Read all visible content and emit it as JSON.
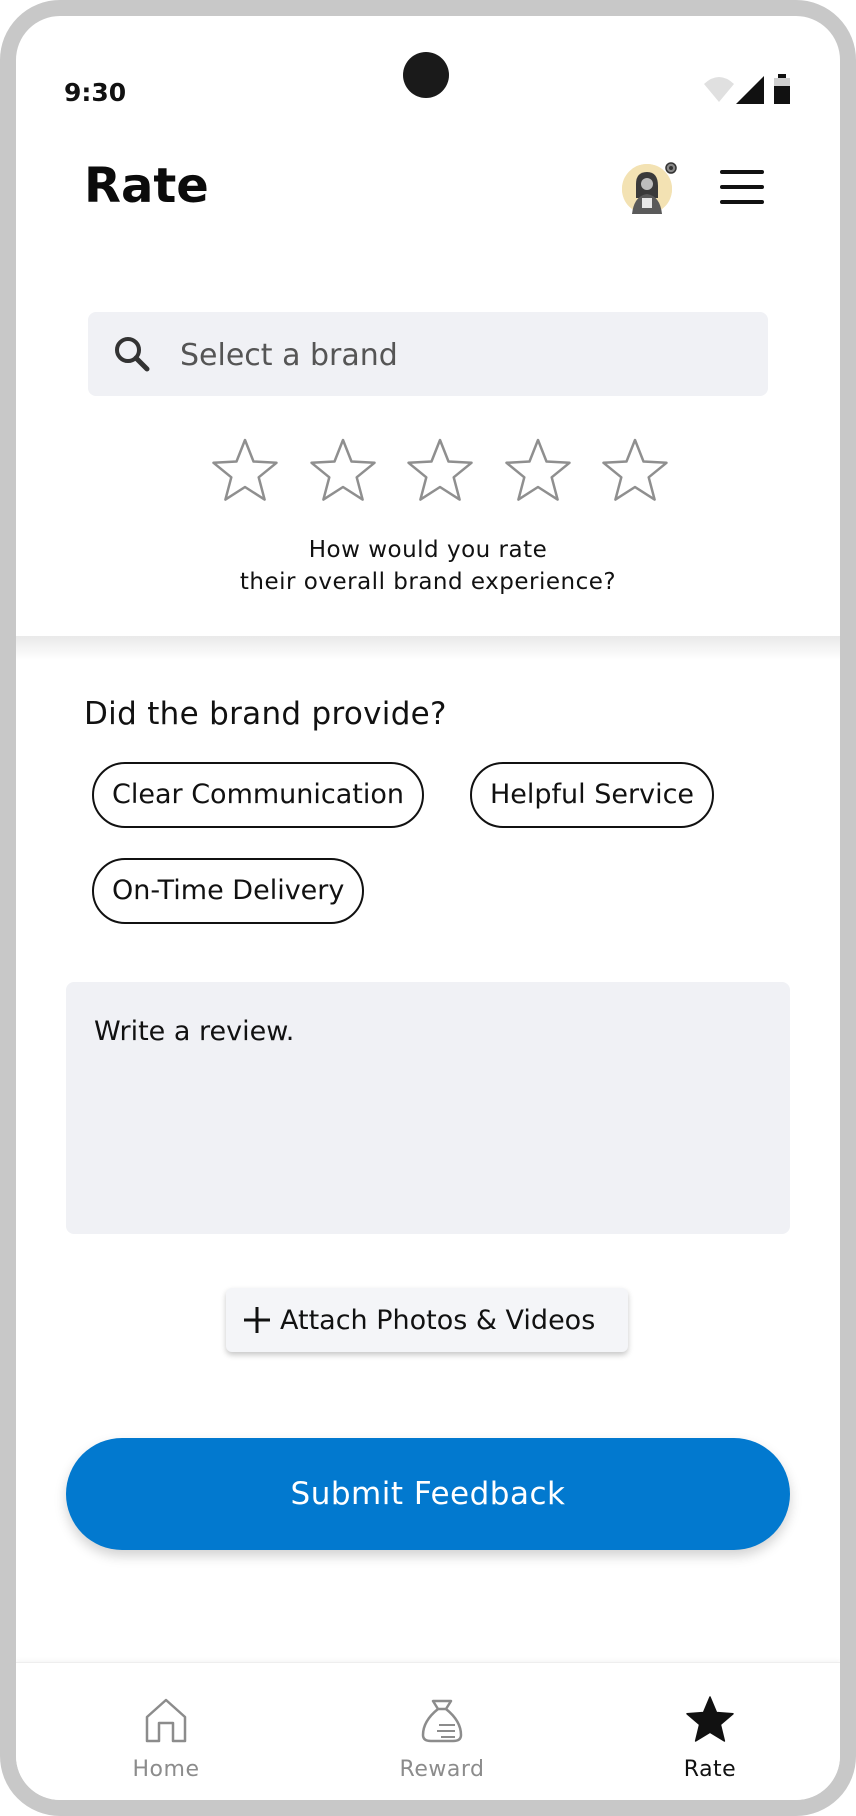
{
  "status_bar": {
    "time": "9:30"
  },
  "header": {
    "title": "Rate"
  },
  "search": {
    "placeholder": "Select a brand"
  },
  "rating": {
    "stars_total": 5,
    "stars_selected": 0,
    "question_line1": "How would you rate",
    "question_line2": "their overall brand experience?"
  },
  "provide": {
    "heading": "Did the brand provide?",
    "chips": [
      "Clear Communication",
      "Helpful Service",
      "On-Time Delivery"
    ]
  },
  "review": {
    "placeholder": "Write a review."
  },
  "attach": {
    "label": "Attach Photos & Videos"
  },
  "submit": {
    "label": "Submit Feedback"
  },
  "bottom_nav": {
    "items": [
      {
        "label": "Home",
        "icon": "home-icon",
        "active": false
      },
      {
        "label": "Reward",
        "icon": "reward-bag-icon",
        "active": false
      },
      {
        "label": "Rate",
        "icon": "star-icon",
        "active": true
      }
    ]
  },
  "colors": {
    "accent": "#0279cf",
    "field_bg": "#f0f1f5",
    "inactive_nav": "#8c8c8c"
  }
}
